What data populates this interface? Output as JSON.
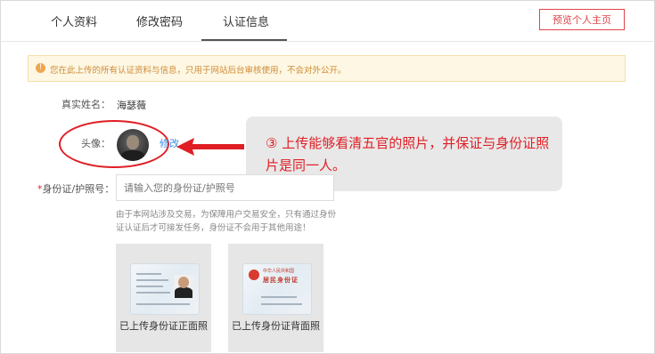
{
  "tabs": [
    {
      "label": "个人资料"
    },
    {
      "label": "修改密码"
    },
    {
      "label": "认证信息"
    }
  ],
  "preview_button": "预览个人主页",
  "notice": "您在此上传的所有认证资料与信息，只用于网站后台审核使用，不会对外公开。",
  "form": {
    "real_name_label": "真实姓名：",
    "real_name_value": "海瑟薇",
    "avatar_label": "头像：",
    "edit_link": "修改",
    "id_label": "*身份证/护照号：",
    "id_placeholder": "请输入您的身份证/护照号",
    "hint": "由于本网站涉及交易，为保障用户交易安全，只有通过身份证认证后才可接发任务，身份证不会用于其他用途！"
  },
  "cards": [
    {
      "caption": "已上传身份证正面照"
    },
    {
      "caption": "已上传身份证背面照"
    }
  ],
  "id_back_text": {
    "line1": "中华人民共和国",
    "line2": "居民身份证"
  },
  "callout": "③ 上传能够看清五官的照片，并保证与身份证照片是同一人。",
  "colors": {
    "accent_red": "#e01e25",
    "link_blue": "#3a8ee6",
    "notice_bg": "#fdf7e3"
  }
}
